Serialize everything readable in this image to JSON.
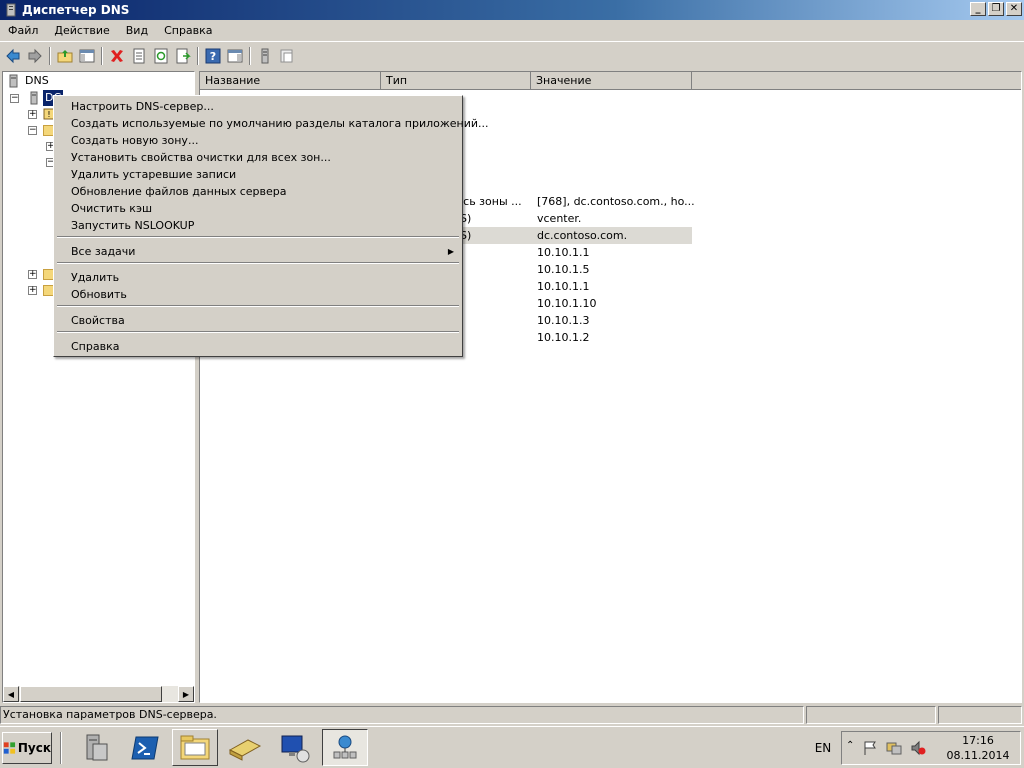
{
  "window": {
    "title": "Диспетчер DNS"
  },
  "menubar": {
    "items": [
      "Файл",
      "Действие",
      "Вид",
      "Справка"
    ]
  },
  "tree": {
    "root": "DNS",
    "server": "DC"
  },
  "list": {
    "columns": [
      "Название",
      "Тип",
      "Значение"
    ],
    "rows": [
      {
        "type": "ись зоны ...",
        "value": "[768], dc.contoso.com., ho..."
      },
      {
        "type": "S)",
        "value": "vcenter."
      },
      {
        "type": "S)",
        "value": "dc.contoso.com."
      },
      {
        "type": "",
        "value": "10.10.1.1"
      },
      {
        "type": "",
        "value": "10.10.1.5"
      },
      {
        "type": "",
        "value": "10.10.1.1"
      },
      {
        "type": "",
        "value": "10.10.1.10"
      },
      {
        "type": "",
        "value": "10.10.1.3"
      },
      {
        "type": "",
        "value": "10.10.1.2"
      }
    ]
  },
  "context_menu": {
    "items": [
      "Настроить DNS-сервер...",
      "Создать используемые по умолчанию разделы каталога приложений...",
      "Создать новую зону...",
      "Установить свойства очистки для всех зон...",
      "Удалить устаревшие записи",
      "Обновление файлов данных сервера",
      "Очистить кэш",
      "Запустить NSLOOKUP",
      "Все задачи",
      "Удалить",
      "Обновить",
      "Свойства",
      "Справка"
    ]
  },
  "statusbar": {
    "text": "Установка параметров DNS-сервера."
  },
  "taskbar": {
    "start_label": "Пуск",
    "language": "EN",
    "time": "17:16",
    "date": "08.11.2014"
  },
  "colors": {
    "title_start": "#0a246a",
    "title_end": "#a6caf0",
    "chrome": "#d4d0c8",
    "selection": "#0a246a"
  }
}
